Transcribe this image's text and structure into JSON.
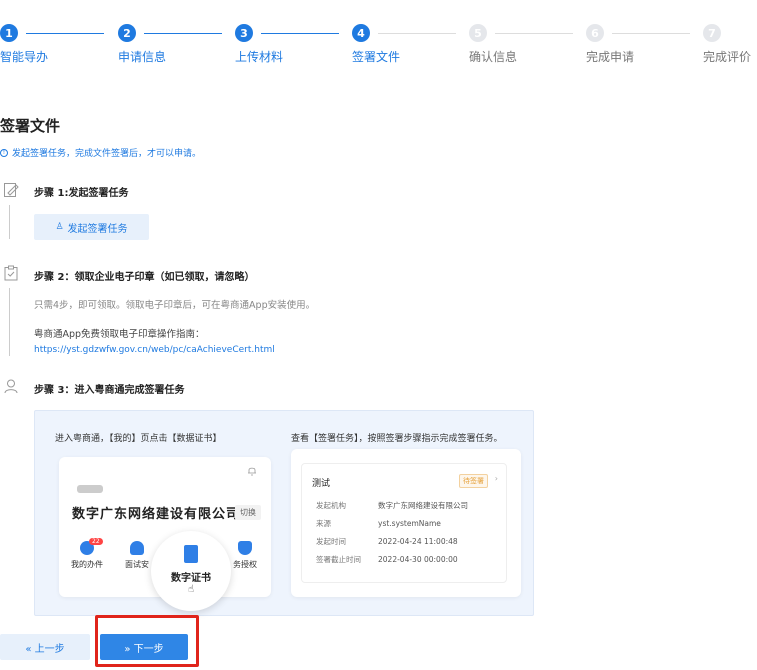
{
  "steps": [
    {
      "num": "1",
      "label": "智能导办",
      "state": "done"
    },
    {
      "num": "2",
      "label": "申请信息",
      "state": "done"
    },
    {
      "num": "3",
      "label": "上传材料",
      "state": "done"
    },
    {
      "num": "4",
      "label": "签署文件",
      "state": "done"
    },
    {
      "num": "5",
      "label": "确认信息",
      "state": "todo"
    },
    {
      "num": "6",
      "label": "完成申请",
      "state": "todo"
    },
    {
      "num": "7",
      "label": "完成评价",
      "state": "todo"
    }
  ],
  "page_title": "签署文件",
  "notice": "发起签署任务，完成文件签署后，才可以申请。",
  "step1": {
    "title": "步骤 1:发起签署任务",
    "button": "发起签署任务"
  },
  "step2": {
    "title": "步骤 2：领取企业电子印章（如已领取，请忽略）",
    "desc": "只需4步，即可领取。领取电子印章后，可在粤商通App安装使用。",
    "guide_label": "粤商通App免费领取电子印章操作指南：",
    "link": "https://yst.gdzwfw.gov.cn/web/pc/caAchieveCert.html"
  },
  "step3": {
    "title": "步骤 3：进入粤商通完成签署任务",
    "left_caption": "进入粤商通，【我的】页点击【数据证书】",
    "right_caption": "查看【签署任务】，按照签署步骤指示完成签署任务。",
    "company": "数字广东网络建设有限公司",
    "switch": "切换",
    "apps": [
      {
        "label": "我的办件",
        "badge": "22"
      },
      {
        "label": "面试安"
      },
      {
        "label": "务授权"
      }
    ],
    "magnifier_label": "数字证书",
    "card": {
      "title": "测试",
      "status": "待签署",
      "rows": [
        {
          "k": "发起机构",
          "v": "数字广东网络建设有限公司"
        },
        {
          "k": "来源",
          "v": "yst.systemName"
        },
        {
          "k": "发起时间",
          "v": "2022-04-24 11:00:48"
        },
        {
          "k": "签署截止时间",
          "v": "2022-04-30 00:00:00"
        }
      ]
    }
  },
  "buttons": {
    "prev": "« 上一步",
    "next": "» 下一步"
  },
  "colors": {
    "accent": "#1f7ae0",
    "highlight": "#e0241b"
  }
}
